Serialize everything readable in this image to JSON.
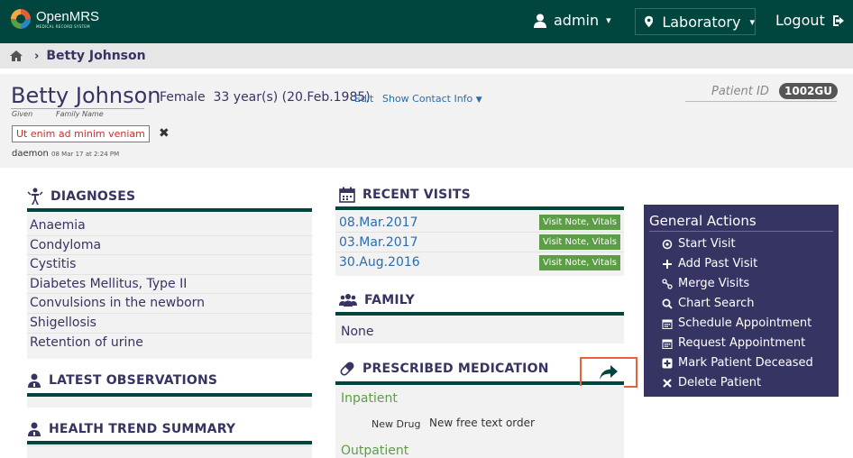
{
  "header": {
    "app_name": "OpenMRS",
    "app_sub": "MEDICAL RECORD SYSTEM",
    "user": "admin",
    "location": "Laboratory",
    "logout": "Logout",
    "colors": {
      "bg": "#00463f"
    }
  },
  "breadcrumb": {
    "patient": "Betty Johnson"
  },
  "patient": {
    "given": "Betty",
    "family": "Johnson",
    "given_label": "Given",
    "family_label": "Family Name",
    "info": "Female  33 year(s) (20.Feb.1985)",
    "edit": "Edit",
    "contact": "Show Contact Info",
    "id_label": "Patient ID",
    "id_value": "1002GU",
    "tag": "Ut enim ad minim veniam",
    "created_by": "daemon",
    "created_at": "08 Mar 17 at 2:24 PM"
  },
  "diagnoses": {
    "title": "DIAGNOSES",
    "items": [
      "Anaemia",
      "Condyloma",
      "Cystitis",
      "Diabetes Mellitus, Type II",
      "Convulsions in the newborn",
      "Shigellosis",
      "Retention of urine"
    ]
  },
  "observations": {
    "title": "LATEST OBSERVATIONS"
  },
  "health_trend": {
    "title": "HEALTH TREND SUMMARY"
  },
  "recent_visits": {
    "title": "RECENT VISITS",
    "items": [
      {
        "date": "08.Mar.2017",
        "badge": "Visit Note, Vitals"
      },
      {
        "date": "03.Mar.2017",
        "badge": "Visit Note, Vitals"
      },
      {
        "date": "30.Aug.2016",
        "badge": "Visit Note, Vitals"
      }
    ]
  },
  "family": {
    "title": "FAMILY",
    "value": "None"
  },
  "medication": {
    "title": "PRESCRIBED MEDICATION",
    "inpatient": "Inpatient",
    "drug_name": "New Drug",
    "drug_order": "New free text order",
    "outpatient": "Outpatient"
  },
  "general_actions": {
    "title": "General Actions",
    "items": [
      {
        "label": "Start Visit",
        "icon": "map-pin-icon"
      },
      {
        "label": "Add Past Visit",
        "icon": "plus-icon"
      },
      {
        "label": "Merge Visits",
        "icon": "merge-icon"
      },
      {
        "label": "Chart Search",
        "icon": "search-icon"
      },
      {
        "label": "Schedule Appointment",
        "icon": "calendar-icon"
      },
      {
        "label": "Request Appointment",
        "icon": "calendar-icon"
      },
      {
        "label": "Mark Patient Deceased",
        "icon": "plus-square-icon"
      },
      {
        "label": "Delete Patient",
        "icon": "close-icon"
      }
    ],
    "colors": {
      "bg": "#363463"
    }
  }
}
